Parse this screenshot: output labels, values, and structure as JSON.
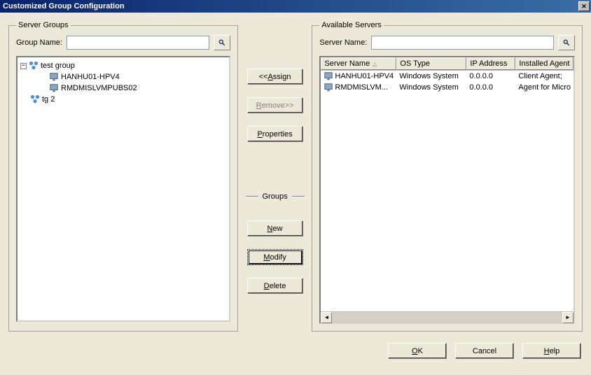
{
  "window": {
    "title": "Customized Group Configuration"
  },
  "left": {
    "legend": "Server Groups",
    "groupname_label": "Group Name:",
    "tree": {
      "root1": "test group",
      "root1_children": [
        "HANHU01-HPV4",
        "RMDMISLVMPUBS02"
      ],
      "root2": "tg 2"
    }
  },
  "middle": {
    "assign": "<<Assign",
    "remove": "Remove>>",
    "properties": "Properties",
    "groups_label": "Groups",
    "new": "New",
    "modify": "Modify",
    "delete": "Delete"
  },
  "right": {
    "legend": "Available Servers",
    "servername_label": "Server Name:",
    "columns": [
      "Server Name",
      "OS Type",
      "IP Address",
      "Installed Agent"
    ],
    "rows": [
      {
        "server": "HANHU01-HPV4",
        "os": "Windows System",
        "ip": "0.0.0.0",
        "agent": "Client Agent;"
      },
      {
        "server": "RMDMISLVM...",
        "os": "Windows System",
        "ip": "0.0.0.0",
        "agent": "Agent for Micro"
      }
    ]
  },
  "footer": {
    "ok": "OK",
    "cancel": "Cancel",
    "help": "Help"
  }
}
